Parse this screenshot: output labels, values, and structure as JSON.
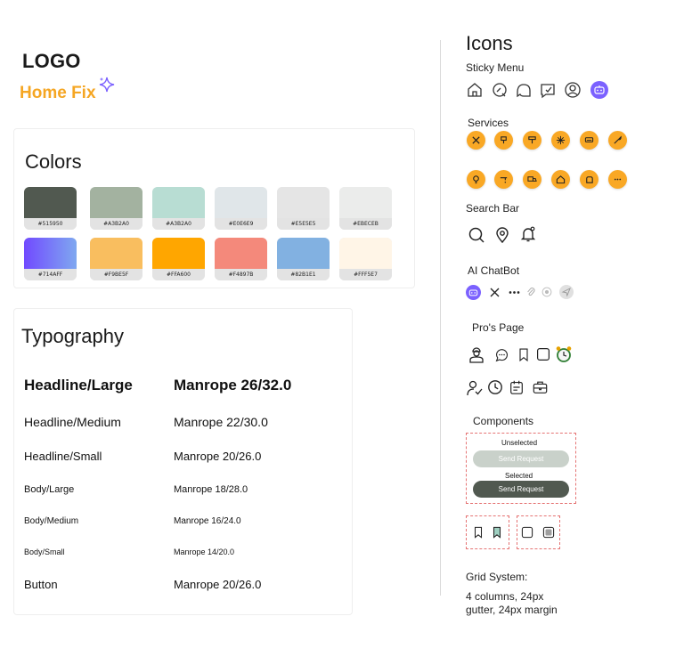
{
  "logo": {
    "title": "LOGO",
    "brand": "Home Fix"
  },
  "colors": {
    "title": "Colors",
    "swatches": [
      {
        "code": "#515950",
        "color": "#515950"
      },
      {
        "code": "#A3B2A0",
        "color": "#A3B2A0"
      },
      {
        "code": "#A3B2A0",
        "color": "#B8DDD3"
      },
      {
        "code": "#E0E6E9",
        "color": "#E0E6E9"
      },
      {
        "code": "#E5E5E5",
        "color": "#E5E5E5"
      },
      {
        "code": "#EBECEB",
        "color": "#EBECEB"
      },
      {
        "code": "#714AFF",
        "color": "#714AFF",
        "gradient_to": "#7FA8F0"
      },
      {
        "code": "#F9BE5F",
        "color": "#F9BE5F"
      },
      {
        "code": "#FFA600",
        "color": "#FFA600"
      },
      {
        "code": "#F4897B",
        "color": "#F4897B"
      },
      {
        "code": "#82B1E1",
        "color": "#82B1E1"
      },
      {
        "code": "#FFF5E7",
        "color": "#FFF5E7"
      }
    ]
  },
  "typography": {
    "title": "Typography",
    "rows": [
      {
        "name": "Headline/Large",
        "spec": "Manrope 26/32.0"
      },
      {
        "name": "Headline/Medium",
        "spec": "Manrope 22/30.0"
      },
      {
        "name": "Headline/Small",
        "spec": "Manrope 20/26.0"
      },
      {
        "name": "Body/Large",
        "spec": "Manrope 18/28.0"
      },
      {
        "name": "Body/Medium",
        "spec": "Manrope 16/24.0"
      },
      {
        "name": "Body/Small",
        "spec": "Manrope 14/20.0"
      },
      {
        "name": "Button",
        "spec": "Manrope 20/26.0"
      }
    ]
  },
  "icons": {
    "title": "Icons",
    "sticky_menu": {
      "label": "Sticky Menu",
      "items": [
        "home-icon",
        "search-chat-icon",
        "chat-bubbles-icon",
        "message-check-icon",
        "profile-icon",
        "bot-icon"
      ]
    },
    "services": {
      "label": "Services",
      "row1": [
        "tools-icon",
        "plumbing-icon",
        "paint-roller-icon",
        "snowflake-icon",
        "ac-unit-icon",
        "gardening-icon"
      ],
      "row2": [
        "lightbulb-icon",
        "faucet-icon",
        "moving-truck-icon",
        "home-icon",
        "cleaning-hand-icon",
        "more-icon"
      ]
    },
    "search_bar": {
      "label": "Search Bar",
      "items": [
        "search-icon",
        "location-pin-icon",
        "notification-bell-icon"
      ]
    },
    "ai_chatbot": {
      "label": "AI ChatBot",
      "items": [
        "bot-icon",
        "close-icon",
        "typing-dots-icon",
        "attachment-icon",
        "mic-icon",
        "send-icon"
      ]
    },
    "pros_page": {
      "label": "Pro's Page",
      "row1": [
        "worker-icon",
        "chat-icon",
        "bookmark-icon",
        "checkbox-icon",
        "alarm-clock-icon"
      ],
      "row2": [
        "user-check-icon",
        "clock-icon",
        "calendar-icon",
        "briefcase-icon"
      ]
    }
  },
  "components": {
    "label": "Components",
    "unselected_label": "Unselected",
    "unselected_button": "Send Request",
    "selected_label": "Selected",
    "selected_button": "Send Request"
  },
  "grid": {
    "label": "Grid System:",
    "line1": "4 columns, 24px",
    "line2": "gutter, 24px margin"
  }
}
